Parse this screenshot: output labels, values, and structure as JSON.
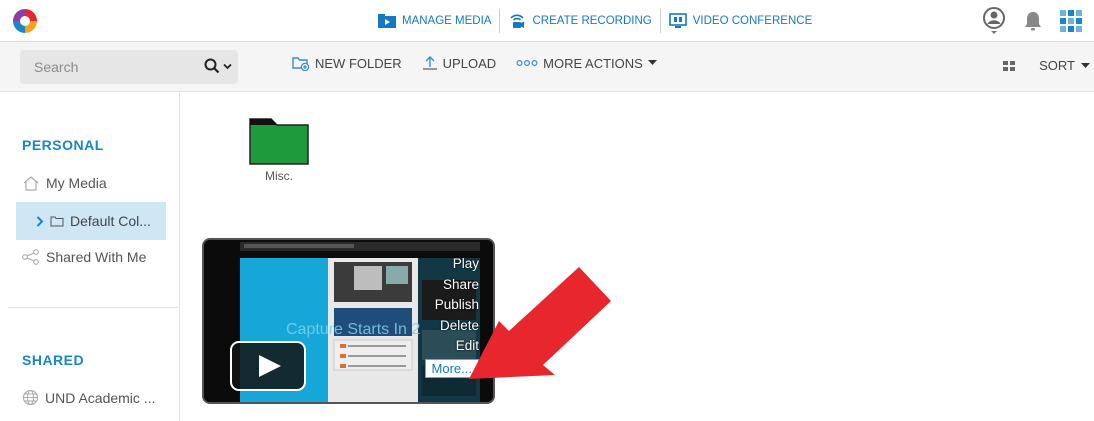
{
  "topnav": {
    "manage_media": "MANAGE MEDIA",
    "create_recording": "CREATE RECORDING",
    "video_conference": "VIDEO CONFERENCE"
  },
  "toolbar": {
    "search_placeholder": "Search",
    "new_folder": "NEW FOLDER",
    "upload": "UPLOAD",
    "more_actions": "MORE ACTIONS",
    "sort": "SORT"
  },
  "sidebar": {
    "personal_title": "PERSONAL",
    "my_media": "My Media",
    "default_collection": "Default Col...",
    "shared_with_me": "Shared With Me",
    "shared_title": "SHARED",
    "und_academic": "UND Academic ..."
  },
  "main": {
    "folder_label": "Misc.",
    "video_title_overlay": "Capture Starts In 2",
    "context_menu": [
      "Play",
      "Share",
      "Publish",
      "Delete",
      "Edit"
    ],
    "more_label": "More..."
  },
  "colors": {
    "accent": "#1479c4",
    "section_title": "#1a86c7",
    "active_bg": "#cfe6f5",
    "folder_green": "#1e9a3d",
    "arrow_red": "#e8262d"
  }
}
